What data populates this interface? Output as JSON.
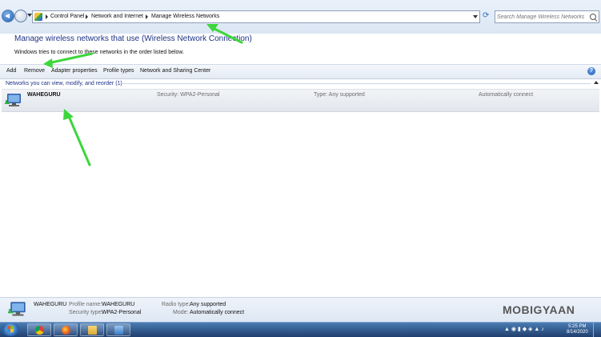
{
  "addressbar": {
    "breadcrumbs": [
      "Control Panel",
      "Network and Internet",
      "Manage Wireless Networks"
    ],
    "search_placeholder": "Search Manage Wireless Networks"
  },
  "header": {
    "title": "Manage wireless networks that use (Wireless Network Connection)",
    "subtitle": "Windows tries to connect to these networks in the order listed below."
  },
  "toolbar": {
    "items": [
      "Add",
      "Remove",
      "Adapter properties",
      "Profile types",
      "Network and Sharing Center"
    ],
    "help": "?"
  },
  "list": {
    "group_label": "Networks you can view, modify, and reorder (1)",
    "networks": [
      {
        "name": "WAHEGURU",
        "security": "Security: WPA2-Personal",
        "type": "Type: Any supported",
        "mode": "Automatically connect"
      }
    ]
  },
  "details": {
    "name": "WAHEGURU",
    "profile_name_label": "Profile name:",
    "profile_name_value": "WAHEGURU",
    "security_type_label": "Security type:",
    "security_type_value": "WPA2-Personal",
    "radio_type_label": "Radio type:",
    "radio_type_value": "Any supported",
    "mode_label": "Mode:",
    "mode_value": "Automatically connect"
  },
  "watermark": "MOBIGYAAN",
  "taskbar": {
    "clock_time": "5:25 PM",
    "clock_date": "8/14/2020"
  },
  "colors": {
    "heading": "#1e3287",
    "annotation_arrow": "#3dd63d",
    "taskbar": "#2a5186"
  }
}
